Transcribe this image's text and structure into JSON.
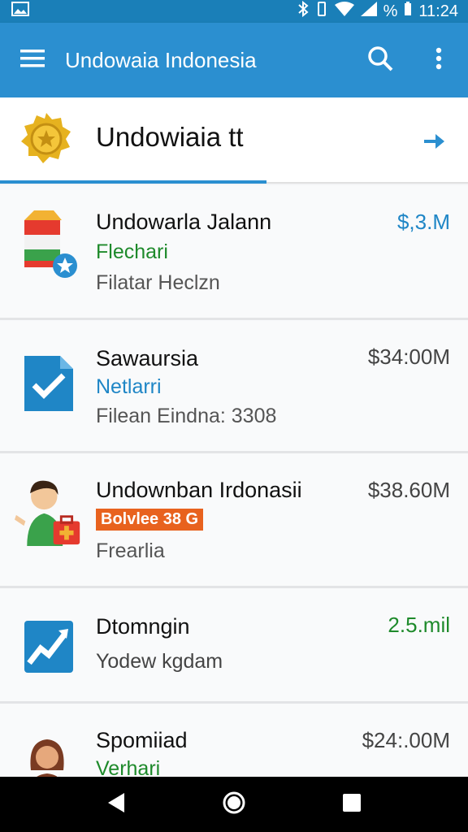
{
  "status": {
    "time": "11:24",
    "battery_label": "%"
  },
  "appbar": {
    "title": "Undowaia Indonesia",
    "menu_icon": "menu-icon",
    "search_icon": "search-icon",
    "more_icon": "more-vert-icon"
  },
  "header": {
    "label": "Undowiaia tt"
  },
  "items": [
    {
      "title": "Undowarla Jalann",
      "subtitle": "Flechari",
      "meta": "Filatar Heclzn",
      "price": "$,3.M",
      "subtitle_color": "#1e8a2b",
      "price_color": "#1f86c6"
    },
    {
      "title": "Sawaursia",
      "subtitle": "Netlarri",
      "meta": "Filean Eindna: 3308",
      "price": "$34:00M",
      "subtitle_color": "#1f86c6",
      "price_color": "#444444"
    },
    {
      "title": "Undownban Irdonasii",
      "tag": "Bolvlee 38 G",
      "meta": "Frearlia",
      "price": "$38.60M",
      "price_color": "#444444"
    },
    {
      "title": "Dtomngin",
      "meta": "Yodew kgdam",
      "price": "2.5.mil",
      "price_color": "#1e8a2b"
    },
    {
      "title": "Spomiiad",
      "subtitle": "Verhari",
      "price": "$24:.00M",
      "subtitle_color": "#1e8a2b",
      "price_color": "#444444"
    }
  ],
  "colors": {
    "appbar": "#2b8fd0",
    "statusbar": "#1a7fb8",
    "accent": "#2b8fd0"
  }
}
